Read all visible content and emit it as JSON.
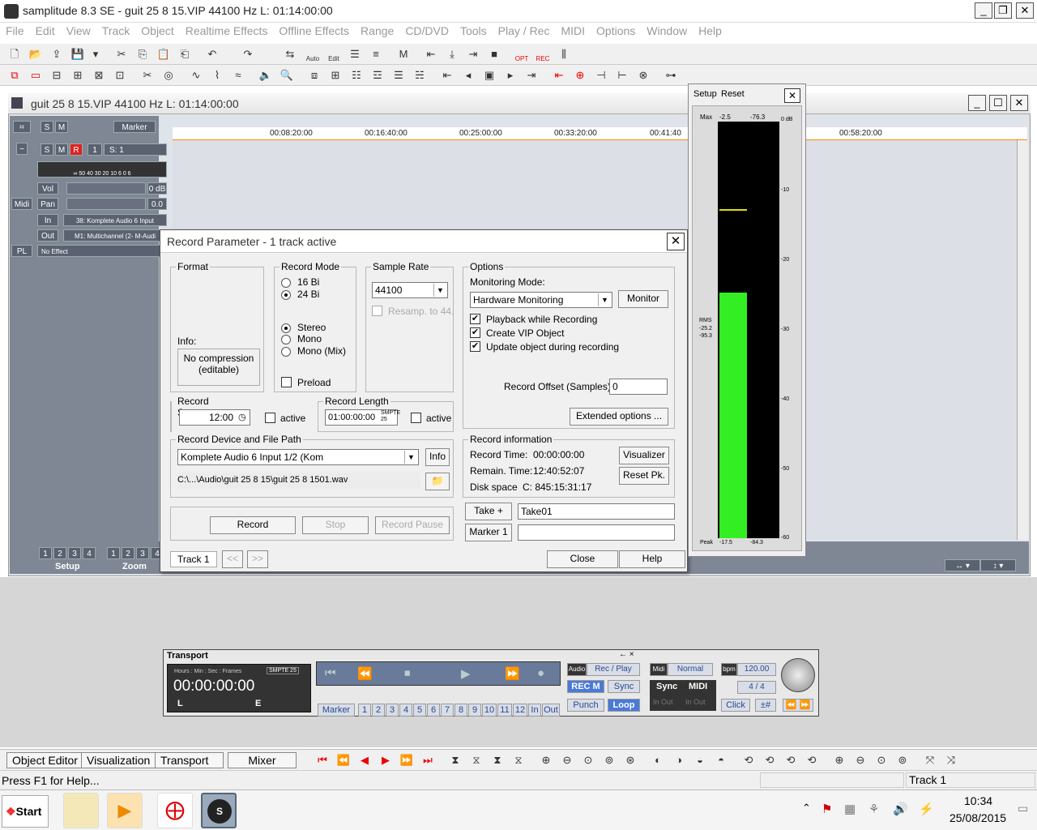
{
  "app": {
    "title": "samplitude 8.3 SE  - guit 25 8 15.VIP   44100 Hz L: 01:14:00:00"
  },
  "menu": [
    "File",
    "Edit",
    "View",
    "Track",
    "Object",
    "Realtime Effects",
    "Offline Effects",
    "Range",
    "CD/DVD",
    "Tools",
    "Play / Rec",
    "MIDI",
    "Options",
    "Window",
    "Help"
  ],
  "toolbar1": {
    "auto_label": "Auto",
    "edit_label": "Edit",
    "opt_label": "OPT",
    "rec_label": "REC"
  },
  "project": {
    "title": "guit 25 8 15.VIP   44100 Hz L: 01:14:00:00"
  },
  "trackpanel": {
    "marker_label": "Marker",
    "track_no": "1",
    "track_name": "S: 1",
    "vol_label": "Vol",
    "vol_value": "0 dB",
    "pan_label": "Pan",
    "pan_value": "0.0",
    "in_label": "In",
    "in_value": "38: Komplete Audio 6 Input",
    "out_label": "Out",
    "out_value": "M1: Multichannel (2- M-Audi",
    "pl_label": "PL",
    "effect_value": "No Effect",
    "midi_label": "Midi",
    "meter_scale": "∞ 50 40 30 20  10  6  0  6",
    "setup_label": "Setup",
    "zoom_label": "Zoom",
    "setup_nums": [
      "1",
      "2",
      "3",
      "4"
    ],
    "zoom_nums": [
      "1",
      "2",
      "3",
      "4"
    ]
  },
  "timeline": [
    "00:08:20:00",
    "00:16:40:00",
    "00:25:00:00",
    "00:33:20:00",
    "00:41:40",
    "00:58:20:00"
  ],
  "dialog": {
    "title": "Record Parameter - 1 track active",
    "format": {
      "legend": "Format",
      "info_label": "Info:",
      "info_text": "No compression (editable)"
    },
    "record_mode": {
      "legend": "Record Mode",
      "bits16": "16 Bi",
      "bits24": "24 Bi",
      "stereo": "Stereo",
      "mono": "Mono",
      "mono_mix": "Mono (Mix)",
      "preload": "Preload"
    },
    "sample_rate": {
      "legend": "Sample Rate",
      "value": "44100",
      "resamp": "Resamp. to 44."
    },
    "options": {
      "legend": "Options",
      "monitoring_label": "Monitoring Mode:",
      "monitoring_value": "Hardware Monitoring",
      "monitor_btn": "Monitor",
      "playback": "Playback while Recording",
      "create_vip": "Create VIP Object",
      "update_obj": "Update object during recording",
      "offset_label": "Record Offset (Samples) :",
      "offset_value": "0",
      "extended_btn": "Extended options ..."
    },
    "record_start": {
      "legend": "Record Start",
      "value": "12:00",
      "active": "active"
    },
    "record_length": {
      "legend": "Record Length",
      "value": "01:00:00:00",
      "smpte": "SMPTE 25",
      "active": "active"
    },
    "device": {
      "legend": "Record Device and File Path",
      "value": "Komplete Audio 6 Input 1/2 (Kom",
      "info_btn": "Info",
      "path": "C:\\...\\Audio\\guit 25 8 15\\guit 25 8 1501.wav"
    },
    "rec_info": {
      "legend": "Record information",
      "time_label": "Record Time:",
      "time_value": "00:00:00:00",
      "remain_label": "Remain. Time:",
      "remain_value": "12:40:52:07",
      "disk_label": "Disk space",
      "disk_value": "C: 845:15:31:17",
      "visualizer_btn": "Visualizer",
      "reset_btn": "Reset Pk."
    },
    "take_btn": "Take +",
    "take_value": "Take01",
    "marker_btn": "Marker 1",
    "marker_value": "",
    "record_btn": "Record",
    "stop_btn": "Stop",
    "pause_btn": "Record Pause",
    "track_label": "Track 1",
    "prev_btn": "<<",
    "next_btn": ">>",
    "close_btn": "Close",
    "help_btn": "Help"
  },
  "meter": {
    "setup": "Setup",
    "reset": "Reset",
    "max_label": "Max",
    "max_l": "-2.5",
    "max_r": "-76.3",
    "scale": [
      "0 dB",
      "-10",
      "-20",
      "-30",
      "-40",
      "-50",
      "-60"
    ],
    "rms_label": "RMS",
    "rms_l": "-25.2",
    "rms_r": "-95.3",
    "peak_label": "Peak",
    "peak_l": "-17.5",
    "peak_r": "-84.3",
    "level_left": 0.59,
    "level_right": 0.0,
    "peak_hold_left": 0.21
  },
  "transport": {
    "title": "Transport",
    "hdr": "Hours : Min : Sec : Frames",
    "smpte": "SMPTE 25",
    "time": "00:00:00:00",
    "L": "L",
    "E": "E",
    "audio": "Audio",
    "recplay": "Rec / Play",
    "recm": "REC M",
    "sync": "Sync",
    "punch": "Punch",
    "loop": "Loop",
    "midi": "Midi",
    "normal": "Normal",
    "sync2": "Sync",
    "midi2": "MIDI",
    "inout1": "In Out",
    "inout2": "In Out",
    "bpm": "bpm",
    "bpm_value": "120.00",
    "sig": "4 / 4",
    "click": "Click",
    "hash": "±#",
    "marker": "Marker",
    "nums": [
      "1",
      "2",
      "3",
      "4",
      "5",
      "6",
      "7",
      "8",
      "9",
      "10",
      "11",
      "12"
    ],
    "inlbl": "In",
    "outlbl": "Out"
  },
  "tabs": [
    "Object Editor",
    "Visualization",
    "Transport",
    "Mixer"
  ],
  "status": {
    "help": "Press F1 for Help...",
    "track": "Track 1"
  },
  "taskbar": {
    "start": "Start",
    "time": "10:34",
    "date": "25/08/2015"
  },
  "colors": {
    "meter_green": "#33ee22",
    "meter_bg": "#000000",
    "accent_blue": "#2a4a8a",
    "rec_red": "#e00000"
  }
}
